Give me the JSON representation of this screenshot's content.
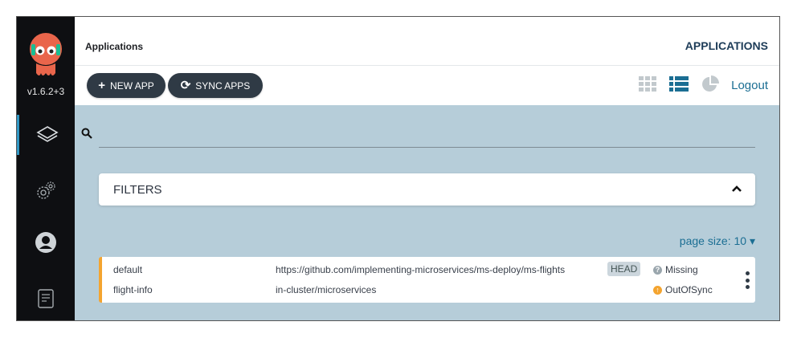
{
  "sidebar": {
    "version": "v1.6.2+3",
    "items": [
      {
        "name": "applications",
        "icon": "layers-icon",
        "active": true
      },
      {
        "name": "settings",
        "icon": "gears-icon",
        "active": false
      },
      {
        "name": "user-info",
        "icon": "user-icon",
        "active": false
      },
      {
        "name": "docs",
        "icon": "docs-icon",
        "active": false
      }
    ]
  },
  "header": {
    "title": "Applications",
    "right_title": "APPLICATIONS",
    "new_app_label": "NEW APP",
    "sync_apps_label": "SYNC APPS",
    "logout_label": "Logout"
  },
  "filters": {
    "label": "FILTERS"
  },
  "page_size": {
    "label": "page size: 10"
  },
  "apps": [
    {
      "project": "default",
      "name": "flight-info",
      "repo": "https://github.com/implementing-microservices/ms-deploy/ms-flights",
      "destination": "in-cluster/microservices",
      "revision": "HEAD",
      "health": "Missing",
      "sync": "OutOfSync"
    }
  ],
  "colors": {
    "sidebar": "#0e0f12",
    "content_bg": "#b6cdd9",
    "button": "#2f3a45",
    "link": "#1b6e93",
    "accent_orange": "#f4a42f",
    "missing_gray": "#9aa6ad"
  }
}
